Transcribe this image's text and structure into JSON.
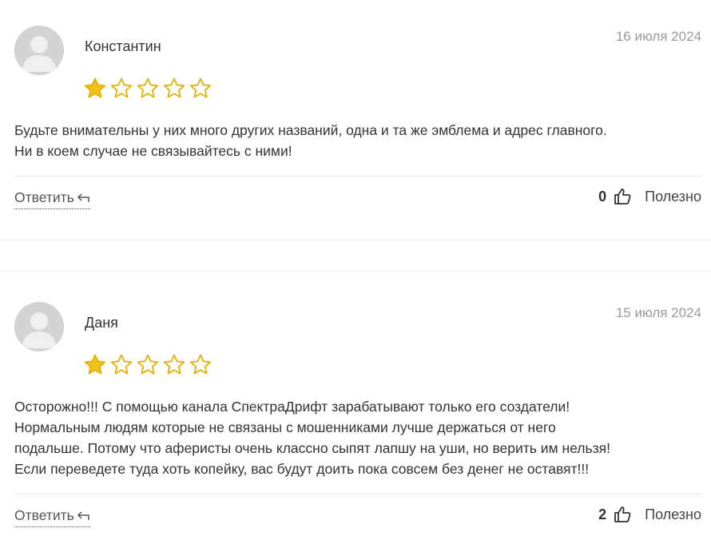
{
  "reviews": [
    {
      "author": "Константин",
      "date": "16 июля 2024",
      "rating": 1,
      "max_rating": 5,
      "text_lines": [
        "Будьте внимательны у них много других названий, одна и та же эмблема и адрес главного.",
        "Ни в коем случае не связывайтесь с ними!"
      ],
      "reply_label": "Ответить",
      "helpful_count": "0",
      "helpful_label": "Полезно"
    },
    {
      "author": "Даня",
      "date": "15 июля 2024",
      "rating": 1,
      "max_rating": 5,
      "text_lines": [
        "Осторожно!!! С помощью канала СпектраДрифт зарабатывают только его создатели!",
        "Нормальным людям которые не связаны с мошенниками лучше держаться от него",
        "подальше. Потому что аферисты очень классно сыпят лапшу на уши, но верить им нельзя!",
        "Если переведете туда хоть копейку, вас будут доить пока совсем без денег не оставят!!!"
      ],
      "reply_label": "Ответить",
      "helpful_count": "2",
      "helpful_label": "Полезно"
    }
  ],
  "colors": {
    "star_fill": "#F2C11B",
    "star_stroke": "#E2B100",
    "avatar_bg": "#D3D3D3",
    "avatar_fg": "#EFEFEF",
    "date": "#9A9A9A"
  },
  "icons": {
    "avatar": "user-silhouette-icon",
    "star": "star-icon",
    "reply": "reply-arrow-icon",
    "helpful": "thumbs-up-icon"
  }
}
